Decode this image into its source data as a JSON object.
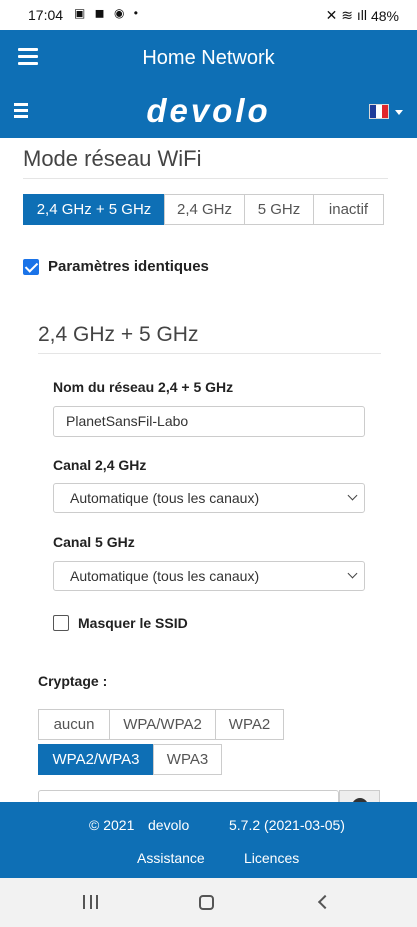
{
  "status": {
    "time": "17:04",
    "notif_icons": "▣ ◼ ◉ •",
    "right_icons": "✕ ≋ ıll",
    "battery": "48%"
  },
  "appbar": {
    "title": "Home Network"
  },
  "brand": {
    "logo": "devolo",
    "language_flag": [
      "#1f3c99",
      "#ffffff",
      "#e2262b"
    ]
  },
  "wifi_mode": {
    "heading": "Mode réseau WiFi",
    "options": [
      "2,4 GHz + 5 GHz",
      "2,4 GHz",
      "5 GHz",
      "inactif"
    ],
    "selected": "2,4 GHz + 5 GHz"
  },
  "identical_params": {
    "label": "Paramètres identiques",
    "checked": true
  },
  "section": {
    "heading": "2,4 GHz + 5 GHz",
    "ssid_label": "Nom du réseau 2,4 + 5 GHz",
    "ssid_value": "PlanetSansFil-Labo",
    "channel24_label": "Canal 2,4 GHz",
    "channel24_value": "Automatique (tous les canaux)",
    "channel5_label": "Canal 5 GHz",
    "channel5_value": "Automatique (tous les canaux)",
    "hide_ssid_label": "Masquer le SSID",
    "hide_ssid_checked": false
  },
  "encryption": {
    "label": "Cryptage :",
    "options": [
      "aucun",
      "WPA/WPA2",
      "WPA2",
      "WPA2/WPA3",
      "WPA3"
    ],
    "selected": "WPA2/WPA3"
  },
  "footer": {
    "copyright": "© 2021",
    "brand": "devolo",
    "version": "5.7.2 (2021-03-05)",
    "assistance": "Assistance",
    "licences": "Licences"
  },
  "colors": {
    "primary": "#0e6fb5",
    "checkbox": "#1a73e8"
  }
}
